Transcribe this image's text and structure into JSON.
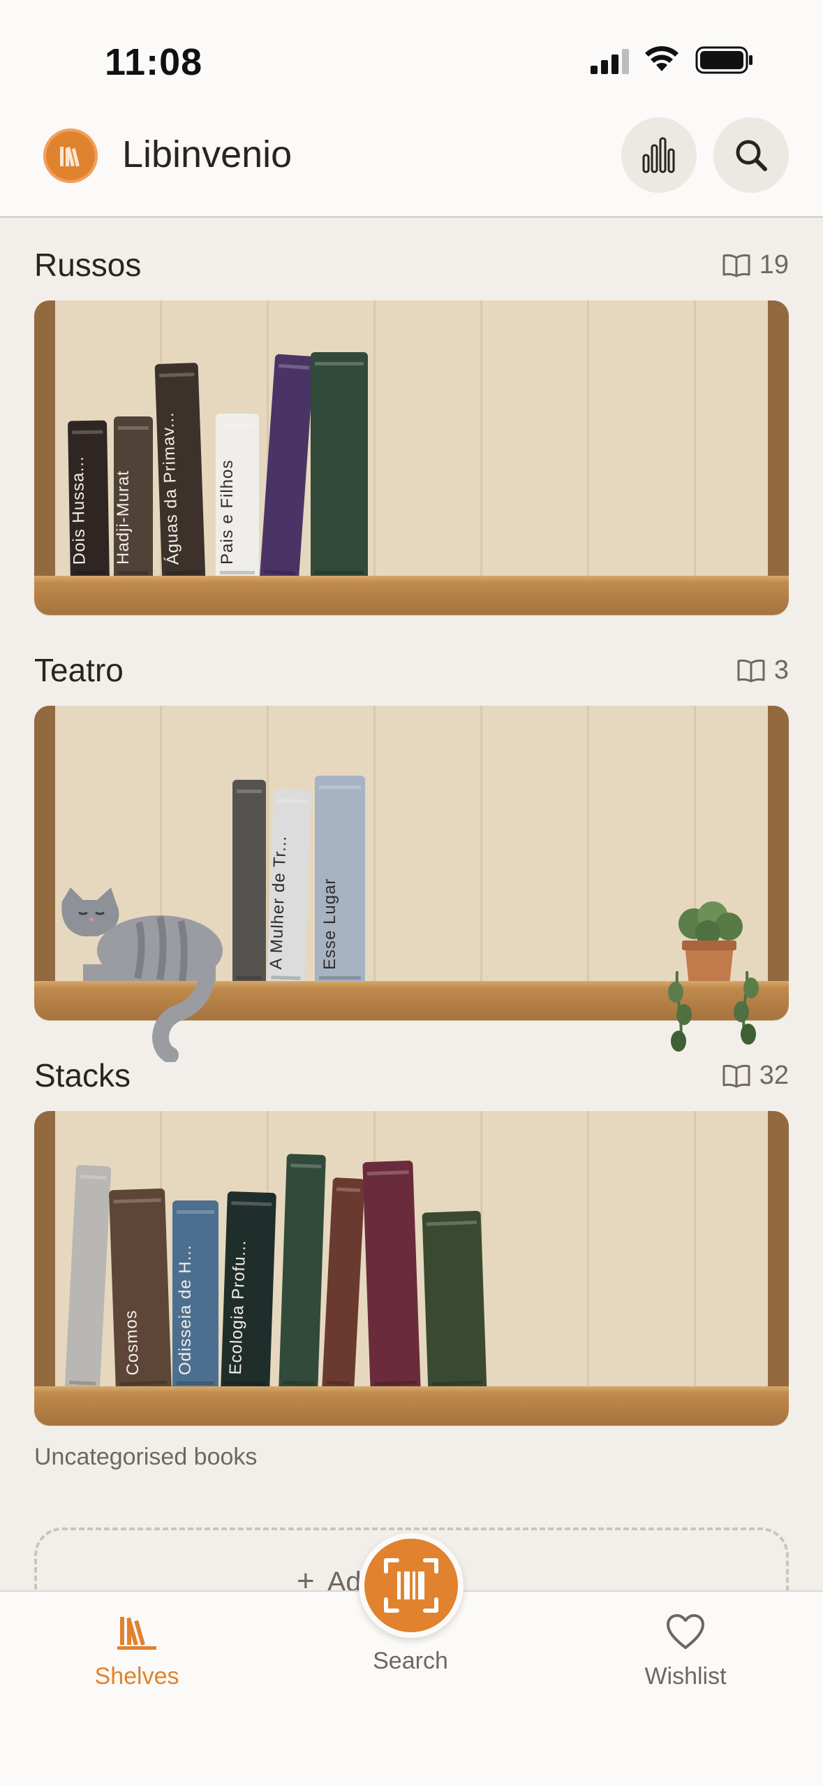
{
  "status_bar": {
    "time": "11:08"
  },
  "header": {
    "app_title": "Libinvenio",
    "logo_icon": "books-logo-icon",
    "stats_icon": "bar-chart-icon",
    "search_icon": "search-icon"
  },
  "shelves": [
    {
      "title": "Russos",
      "count": "19",
      "books": [
        {
          "title": "Dois Hussa...",
          "color": "#2f2624"
        },
        {
          "title": "Hadji-Murat",
          "color": "#4f4237"
        },
        {
          "title": "Águas da Primav...",
          "color": "#3d322b"
        },
        {
          "title": "Pais e Filhos",
          "color": "#efeeea"
        },
        {
          "title": "",
          "color": "#4a3466"
        },
        {
          "title": "",
          "color": "#314a39"
        }
      ]
    },
    {
      "title": "Teatro",
      "count": "3",
      "books": [
        {
          "title": "",
          "color": "#55534f"
        },
        {
          "title": "A Mulher de Tr...",
          "color": "#dcdcdc"
        },
        {
          "title": "Esse Lugar",
          "color": "#a7b3c3"
        }
      ]
    },
    {
      "title": "Stacks",
      "count": "32",
      "books": [
        {
          "title": "",
          "color": "#b9b7b3"
        },
        {
          "title": "Cosmos",
          "color": "#5d4637"
        },
        {
          "title": "Odisseia de H...",
          "color": "#4c6f8f"
        },
        {
          "title": "Ecologia Profu...",
          "color": "#1f2e2b"
        },
        {
          "title": "",
          "color": "#314a3a"
        },
        {
          "title": "",
          "color": "#6a3a30"
        },
        {
          "title": "",
          "color": "#6a2c3c"
        },
        {
          "title": "",
          "color": "#3a4a30"
        }
      ]
    }
  ],
  "uncategorised_label": "Uncategorised books",
  "add_shelf_label": "Add shelf",
  "tabs": {
    "shelves": "Shelves",
    "search": "Search",
    "wishlist": "Wishlist"
  },
  "colors": {
    "accent": "#e1822e",
    "background": "#f2efeb",
    "shelf_wood": "#a6733e"
  }
}
